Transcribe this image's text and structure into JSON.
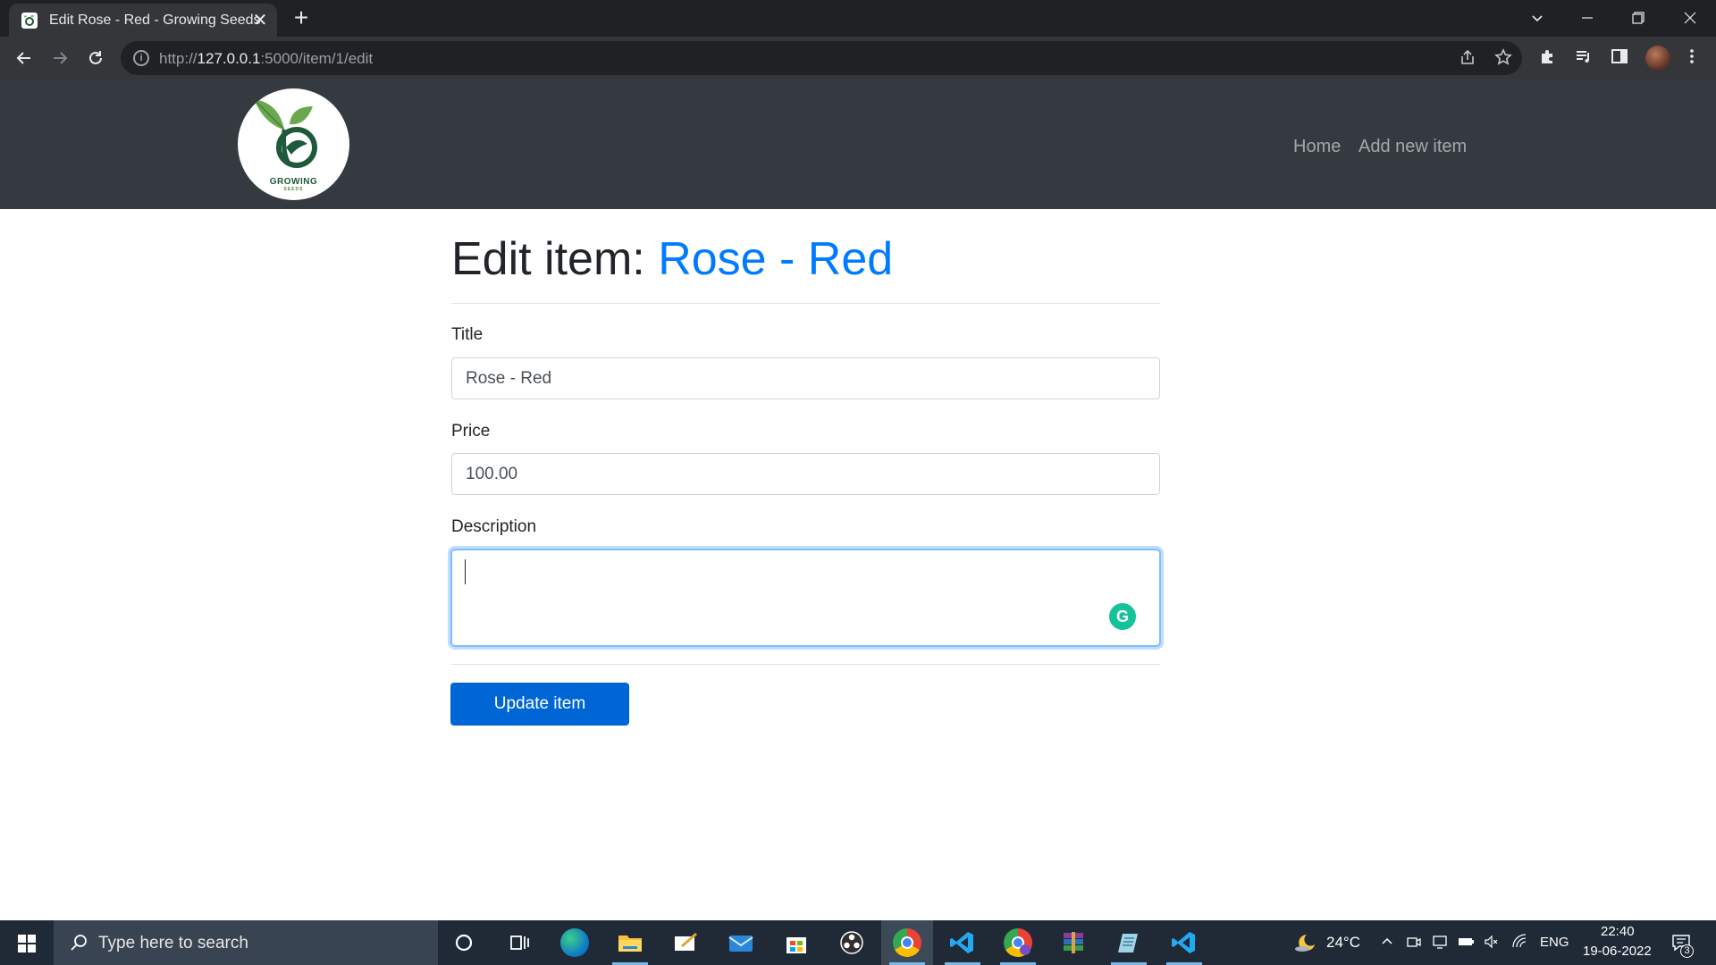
{
  "browser": {
    "tab_title": "Edit Rose - Red - Growing Seeds",
    "tab_close": "✕",
    "new_tab": "+",
    "url_scheme": "http://",
    "url_host": "127.0.0.1",
    "url_rest": ":5000/item/1/edit"
  },
  "site": {
    "logo_text": "GROWING",
    "logo_subtext": "SEEDS",
    "nav": {
      "home": "Home",
      "add_new_item": "Add new item"
    }
  },
  "page": {
    "heading_prefix": "Edit item:",
    "item_name": "Rose - Red"
  },
  "form": {
    "title_label": "Title",
    "title_value": "Rose - Red",
    "price_label": "Price",
    "price_value": "100.00",
    "description_label": "Description",
    "description_value": "",
    "submit_label": "Update item"
  },
  "taskbar": {
    "search_placeholder": "Type here to search",
    "weather_temp": "24°C",
    "language": "ENG",
    "time": "22:40",
    "date": "19-06-2022",
    "notification_count": "3"
  },
  "colors": {
    "navbar": "#343a40",
    "accent": "#007bff",
    "button": "#0066d6",
    "grammarly": "#15c39a"
  }
}
